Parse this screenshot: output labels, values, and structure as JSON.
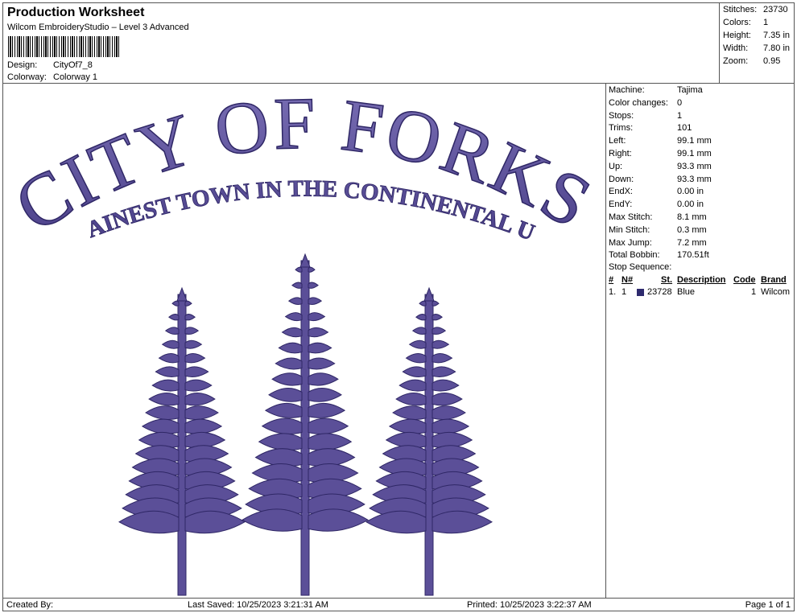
{
  "header": {
    "title": "Production Worksheet",
    "software": "Wilcom EmbroideryStudio – Level 3 Advanced",
    "design_label": "Design:",
    "design_value": "CityOf7_8",
    "colorway_label": "Colorway:",
    "colorway_value": "Colorway 1"
  },
  "stats": [
    {
      "label": "Stitches:",
      "value": "23730"
    },
    {
      "label": "Colors:",
      "value": "1"
    },
    {
      "label": "Height:",
      "value": "7.35 in"
    },
    {
      "label": "Width:",
      "value": "7.80 in"
    },
    {
      "label": "Zoom:",
      "value": "0.95"
    }
  ],
  "details": [
    {
      "label": "Machine:",
      "value": "Tajima"
    },
    {
      "label": "Color changes:",
      "value": "0"
    },
    {
      "label": "Stops:",
      "value": "1"
    },
    {
      "label": "Trims:",
      "value": "101"
    },
    {
      "label": "Left:",
      "value": "99.1 mm"
    },
    {
      "label": "Right:",
      "value": "99.1 mm"
    },
    {
      "label": "Up:",
      "value": "93.3 mm"
    },
    {
      "label": "Down:",
      "value": "93.3 mm"
    },
    {
      "label": "EndX:",
      "value": "0.00 in"
    },
    {
      "label": "EndY:",
      "value": "0.00 in"
    },
    {
      "label": "Max Stitch:",
      "value": "8.1 mm"
    },
    {
      "label": "Min Stitch:",
      "value": "0.3 mm"
    },
    {
      "label": "Max Jump:",
      "value": "7.2 mm"
    },
    {
      "label": "Total Bobbin:",
      "value": "170.51ft"
    }
  ],
  "stop_sequence": {
    "title": "Stop Sequence:",
    "headers": {
      "index": "#",
      "n": "N#",
      "st": "St.",
      "description": "Description",
      "code": "Code",
      "brand": "Brand"
    },
    "rows": [
      {
        "index": "1.",
        "n": "1",
        "color": "#2e2a6e",
        "st": "23728",
        "description": "Blue",
        "code": "1",
        "brand": "Wilcom"
      }
    ]
  },
  "design": {
    "line1": "CITY OF FORKS",
    "line2": "RAINEST TOWN IN THE CONTINENTAL U.S.",
    "thread_color": "#5b4f98",
    "thread_shadow": "#2f2766"
  },
  "footer": {
    "created_by": "Created By:",
    "last_saved": "Last Saved: 10/25/2023 3:21:31 AM",
    "printed": "Printed: 10/25/2023 3:22:37 AM",
    "page": "Page 1 of 1"
  }
}
